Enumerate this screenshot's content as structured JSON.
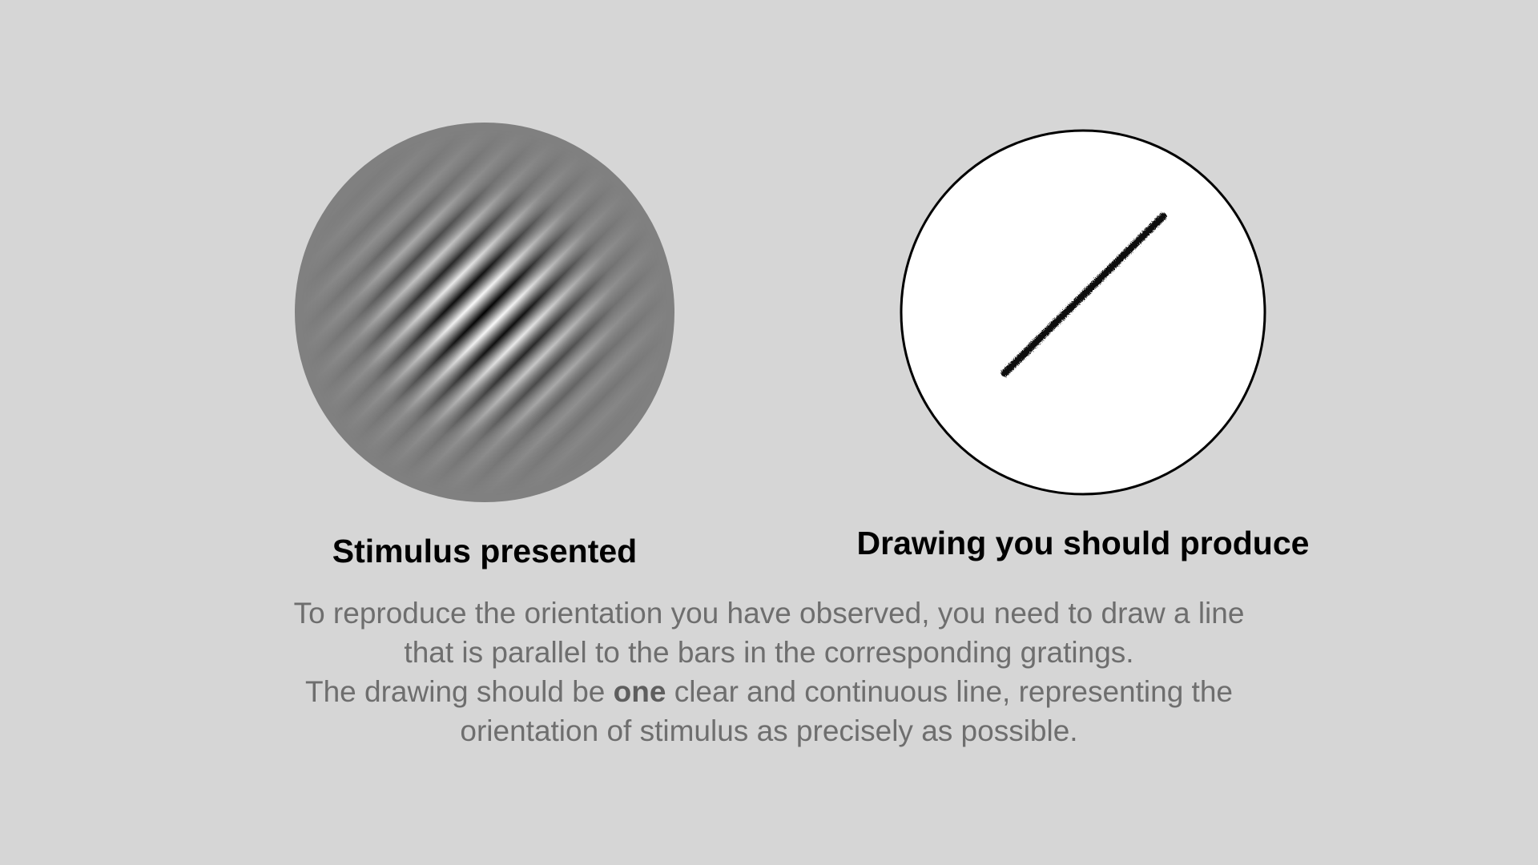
{
  "stimulus": {
    "caption": "Stimulus presented",
    "background_color": "#808080",
    "grating_orientation_deg": 45
  },
  "drawing": {
    "caption": "Drawing you should produce",
    "circle_fill": "#ffffff",
    "line_color": "#111111"
  },
  "instructions": {
    "line1": "To reproduce the orientation you have observed, you need to draw a line",
    "line2": "that is parallel to the bars in the corresponding gratings.",
    "line3_before": "The drawing should be ",
    "line3_bold": "one",
    "line3_after": " clear and continuous line, representing the",
    "line4": "orientation of stimulus as precisely as possible."
  },
  "page_background": "#d6d6d6"
}
